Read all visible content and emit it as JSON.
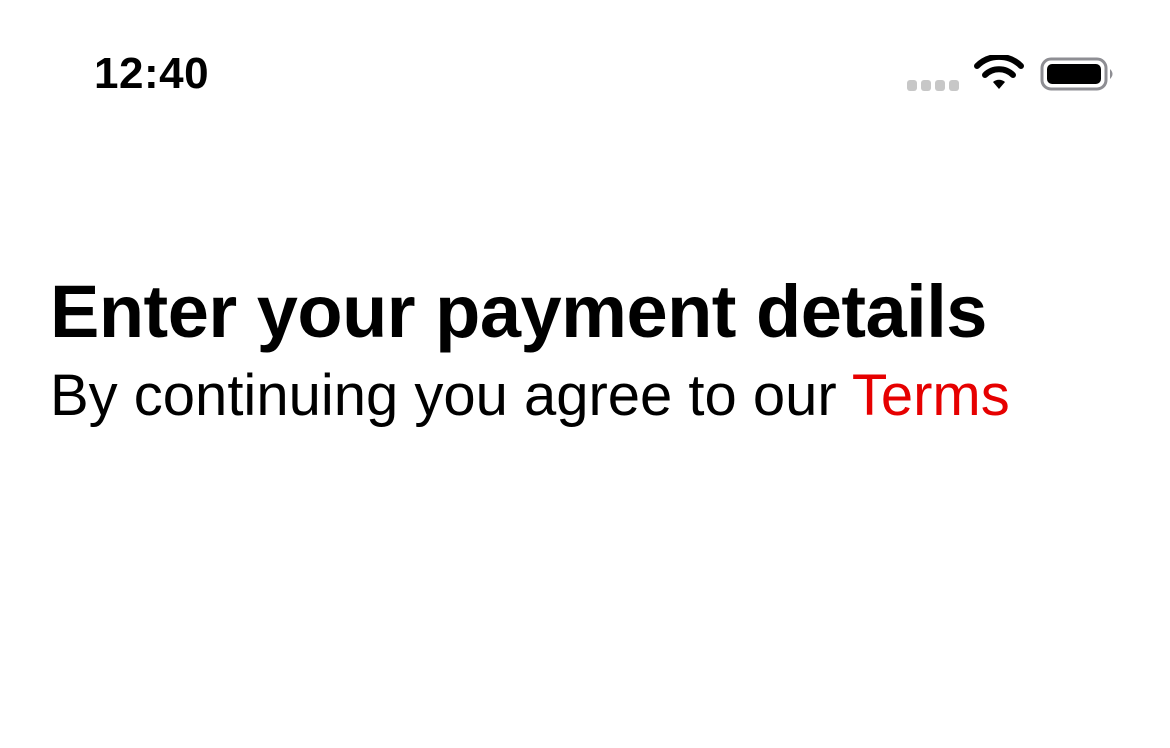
{
  "status_bar": {
    "time": "12:40",
    "signal_icon": "cellular-signal-icon",
    "wifi_icon": "wifi-icon",
    "battery_icon": "battery-icon"
  },
  "main": {
    "title": "Enter your payment details",
    "subtitle_prefix": "By continuing you agree to our",
    "terms_link": "Terms"
  },
  "colors": {
    "text": "#000000",
    "link": "#e60000",
    "background": "#ffffff",
    "inactive_signal": "#c7c7c7"
  }
}
